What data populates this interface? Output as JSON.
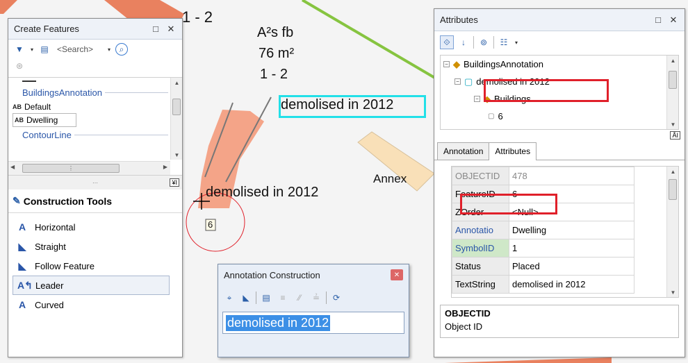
{
  "map": {
    "labels": {
      "lot_top": "1 - 2",
      "area_line1": "A²s fb",
      "area_line2": "76 m²",
      "area_line3": "1 - 2",
      "selected_annotation": "demolised in 2012",
      "annotation_text": "demolised in 2012",
      "annex": "Annex",
      "feature_id": "6"
    }
  },
  "create_features": {
    "title": "Create Features",
    "search_placeholder": "<Search>",
    "groups": [
      {
        "label": "BuildingsAnnotation",
        "items": [
          "Default",
          "Dwelling"
        ]
      },
      {
        "label": "ContourLine"
      }
    ],
    "item_prefix": "AB",
    "construction_tools": {
      "header": "Construction Tools",
      "tools": [
        "Horizontal",
        "Straight",
        "Follow Feature",
        "Leader",
        "Curved"
      ],
      "selected": "Leader"
    }
  },
  "annotation_construction": {
    "title": "Annotation Construction",
    "text_value": "demolised in 2012"
  },
  "attributes": {
    "title": "Attributes",
    "tree": {
      "root": "BuildingsAnnotation",
      "child": "demolised in 2012",
      "related": "Buildings",
      "related_child": "6"
    },
    "tabs": [
      "Annotation",
      "Attributes"
    ],
    "active_tab": "Attributes",
    "rows": [
      {
        "name": "OBJECTID",
        "value": "478"
      },
      {
        "name": "FeatureID",
        "value": "6"
      },
      {
        "name": "ZOrder",
        "value": "<Null>"
      },
      {
        "name": "Annotatio",
        "value": "Dwelling"
      },
      {
        "name": "SymbolID",
        "value": "1"
      },
      {
        "name": "Status",
        "value": "Placed"
      },
      {
        "name": "TextString",
        "value": "demolised in 2012"
      }
    ],
    "description": {
      "title": "OBJECTID",
      "text": "Object ID"
    }
  },
  "colors": {
    "building_fill": "#f4a488",
    "building_dark": "#e9815f",
    "annex_fill": "#f9e0b8",
    "highlight_red": "#e0202a",
    "highlight_cyan": "#22e0e8",
    "selection_blue": "#3c8fe6"
  }
}
